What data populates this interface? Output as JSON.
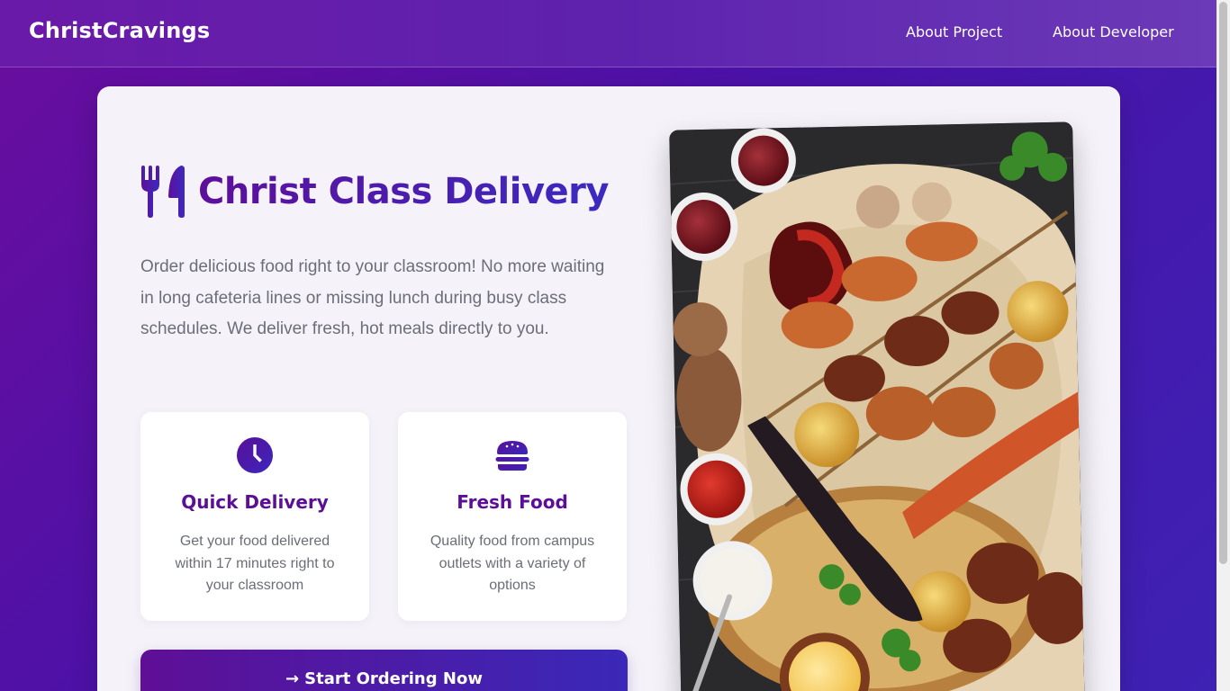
{
  "navbar": {
    "brand": "ChristCravings",
    "links": [
      "About Project",
      "About Developer"
    ]
  },
  "hero": {
    "title": "Christ Class Delivery",
    "description": "Order delicious food right to your classroom! No more waiting in long cafeteria lines or missing lunch during busy class schedules. We deliver fresh, hot meals directly to you.",
    "features": [
      {
        "title": "Quick Delivery",
        "description": "Get your food delivered within 17 minutes right to your classroom",
        "icon": "clock-icon"
      },
      {
        "title": "Fresh Food",
        "description": "Quality food from campus outlets with a variety of options",
        "icon": "burger-icon"
      }
    ],
    "cta": {
      "label": "Start Ordering Now",
      "arrow": "→"
    }
  },
  "colors": {
    "accent_start": "#5e0f96",
    "accent_end": "#3a28b8",
    "background": "#4a12a8",
    "card": "#f5f3f9"
  }
}
